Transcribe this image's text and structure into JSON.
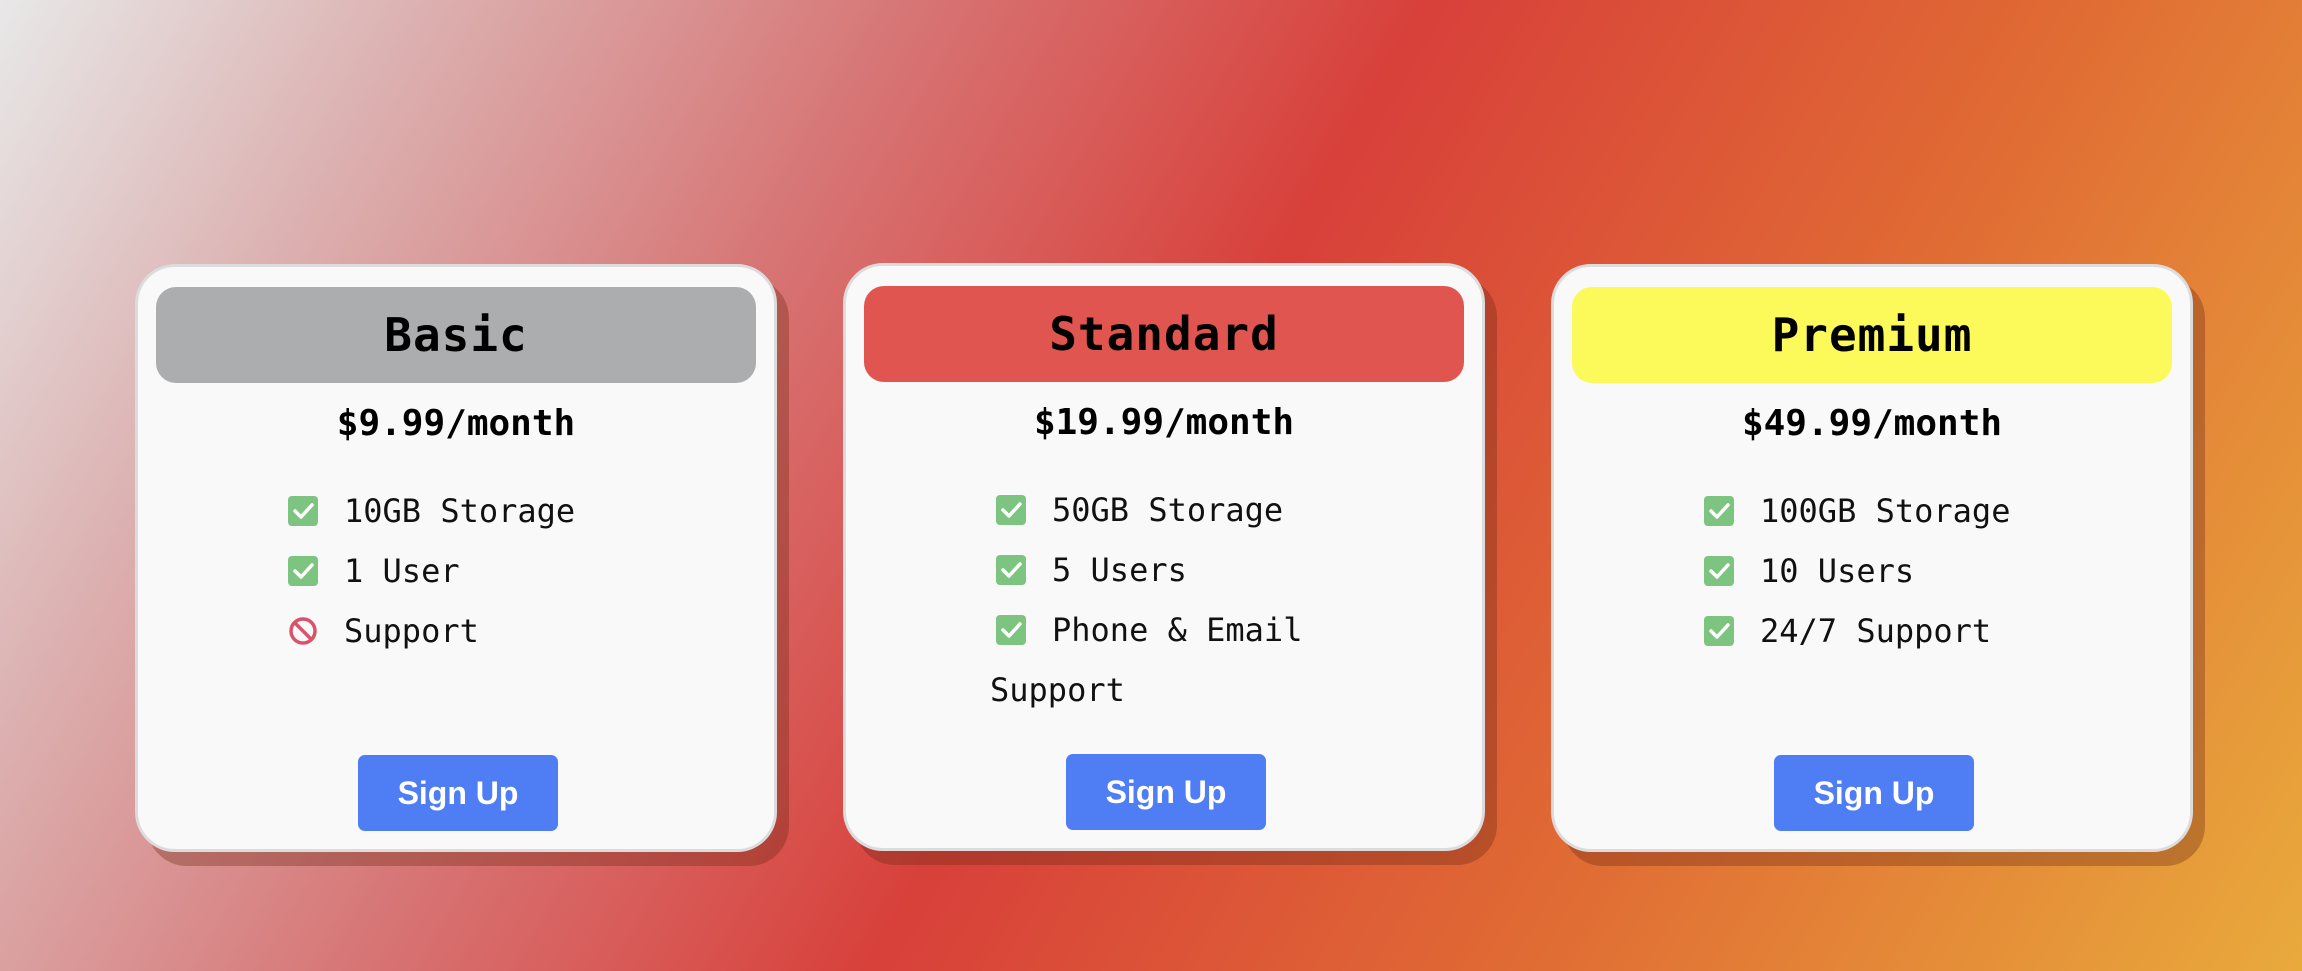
{
  "colors": {
    "basic_header": "#acadae",
    "standard_header": "#e05550",
    "premium_header": "#fcfa5a",
    "button": "#4f7df3",
    "check": "#7cc47f",
    "prohibited": "#d9536b"
  },
  "plans": [
    {
      "name": "Basic",
      "price": "$9.99/month",
      "features": [
        {
          "icon": "check-icon",
          "text": "10GB Storage"
        },
        {
          "icon": "check-icon",
          "text": "1 User"
        },
        {
          "icon": "prohibited-icon",
          "text": "Support"
        }
      ],
      "button_label": "Sign Up"
    },
    {
      "name": "Standard",
      "price": "$19.99/month",
      "features": [
        {
          "icon": "check-icon",
          "text": "50GB Storage"
        },
        {
          "icon": "check-icon",
          "text": "5 Users"
        },
        {
          "icon": "check-icon",
          "text": "Phone & Email Support"
        }
      ],
      "button_label": "Sign Up"
    },
    {
      "name": "Premium",
      "price": "$49.99/month",
      "features": [
        {
          "icon": "check-icon",
          "text": "100GB Storage"
        },
        {
          "icon": "check-icon",
          "text": "10 Users"
        },
        {
          "icon": "check-icon",
          "text": "24/7 Support"
        }
      ],
      "button_label": "Sign Up"
    }
  ]
}
